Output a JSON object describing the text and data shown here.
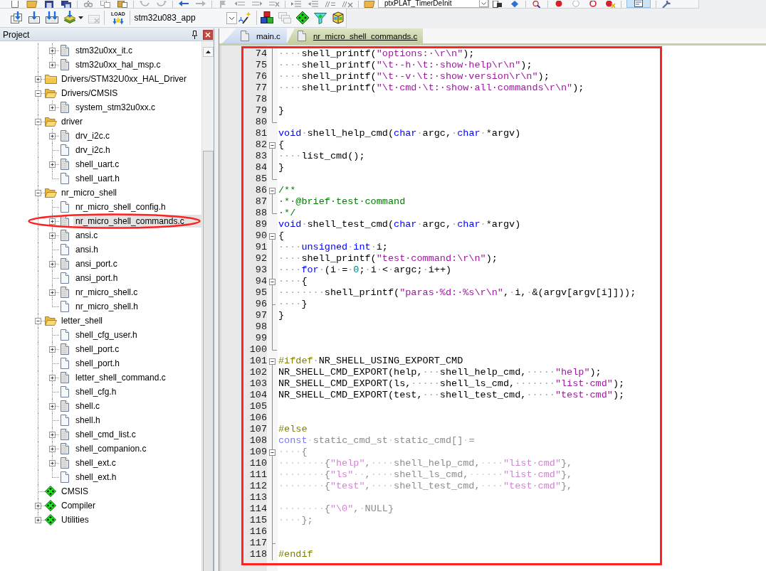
{
  "toolbar_top": {
    "groups": [
      {
        "items": [
          {
            "kind": "new",
            "pressed": false
          },
          {
            "kind": "open",
            "pressed": false
          },
          {
            "kind": "save",
            "pressed": false
          },
          {
            "kind": "save_all",
            "pressed": false
          }
        ]
      },
      {
        "items": [
          {
            "kind": "cut",
            "pressed": false
          },
          {
            "kind": "copy",
            "pressed": false
          },
          {
            "kind": "paste",
            "pressed": false
          }
        ]
      },
      {
        "items": [
          {
            "kind": "undo",
            "pressed": false
          },
          {
            "kind": "redo",
            "pressed": false
          }
        ]
      },
      {
        "items": [
          {
            "kind": "back",
            "pressed": false
          },
          {
            "kind": "forward",
            "pressed": false
          }
        ]
      },
      {
        "items": [
          {
            "kind": "bookmark",
            "pressed": false
          },
          {
            "kind": "bookmark_prev",
            "pressed": false
          },
          {
            "kind": "bookmark_next",
            "pressed": false
          },
          {
            "kind": "bookmark_clear",
            "pressed": false
          }
        ]
      },
      {
        "items": [
          {
            "kind": "indent",
            "pressed": false
          },
          {
            "kind": "outdent",
            "pressed": false
          },
          {
            "kind": "comment",
            "pressed": false
          },
          {
            "kind": "uncomment",
            "pressed": false
          }
        ]
      },
      {
        "items": [
          {
            "kind": "find_in_files",
            "pressed": false
          },
          {
            "kind": "dropdown",
            "value": "ptxPLAT_TimerDeInit"
          },
          {
            "kind": "find",
            "pressed": false
          },
          {
            "kind": "incremental_find",
            "pressed": false
          }
        ]
      },
      {
        "items": [
          {
            "kind": "browse",
            "pressed": false
          }
        ]
      },
      {
        "items": [
          {
            "kind": "breakpoint",
            "pressed": false
          },
          {
            "kind": "breakpoint_off",
            "pressed": false
          },
          {
            "kind": "breakpoint_ring",
            "pressed": false
          },
          {
            "kind": "breakpoint_kill",
            "pressed": false
          }
        ]
      },
      {
        "items": [
          {
            "kind": "window",
            "pressed": true
          }
        ]
      },
      {
        "items": [
          {
            "kind": "configure",
            "pressed": false
          }
        ]
      }
    ]
  },
  "toolbar_build": {
    "groups": [
      {
        "items": [
          {
            "kind": "translate",
            "disabled": false
          },
          {
            "kind": "build",
            "disabled": false
          },
          {
            "kind": "rebuild",
            "disabled": false
          },
          {
            "kind": "batch_build",
            "disabled": false
          },
          {
            "kind": "stop_build",
            "disabled": true
          }
        ]
      },
      {
        "items": [
          {
            "kind": "load",
            "label": "LOAD",
            "disabled": false
          }
        ]
      },
      {
        "items": [
          {
            "kind": "dropdown",
            "value": "stm32u083_app"
          },
          {
            "kind": "options",
            "disabled": false
          }
        ]
      },
      {
        "items": [
          {
            "kind": "components",
            "disabled": false
          },
          {
            "kind": "windows",
            "disabled": true
          },
          {
            "kind": "diamond",
            "disabled": false
          },
          {
            "kind": "funnel",
            "disabled": false
          },
          {
            "kind": "packs",
            "disabled": false
          }
        ]
      }
    ]
  },
  "project": {
    "title": "Project",
    "tree": [
      {
        "children": [
          {
            "label": "stm32u0xx_it.c",
            "kind": "source",
            "expanded": false,
            "selected": false
          },
          {
            "label": "stm32u0xx_hal_msp.c",
            "kind": "source",
            "expanded": false,
            "selected": false
          }
        ]
      },
      {
        "label": "Drivers/STM32U0xx_HAL_Driver",
        "kind": "folder",
        "expanded": false,
        "selected": false
      },
      {
        "label": "Drivers/CMSIS",
        "kind": "folder",
        "expanded": true,
        "selected": false,
        "children": [
          {
            "label": "system_stm32u0xx.c",
            "kind": "source",
            "expanded": false,
            "selected": false
          }
        ]
      },
      {
        "label": "driver",
        "kind": "folder",
        "expanded": true,
        "selected": false,
        "children": [
          {
            "label": "drv_i2c.c",
            "kind": "source",
            "expanded": false,
            "selected": false
          },
          {
            "label": "drv_i2c.h",
            "kind": "header",
            "selected": false
          },
          {
            "label": "shell_uart.c",
            "kind": "source",
            "expanded": false,
            "selected": false
          },
          {
            "label": "shell_uart.h",
            "kind": "header",
            "selected": false
          }
        ]
      },
      {
        "label": "nr_micro_shell",
        "kind": "folder",
        "expanded": true,
        "selected": false,
        "children": [
          {
            "label": "nr_micro_shell_config.h",
            "kind": "header",
            "selected": false
          },
          {
            "label": "nr_micro_shell_commands.c",
            "kind": "source",
            "expanded": false,
            "selected": true
          },
          {
            "label": "ansi.c",
            "kind": "source",
            "expanded": false,
            "selected": false
          },
          {
            "label": "ansi.h",
            "kind": "header",
            "selected": false
          },
          {
            "label": "ansi_port.c",
            "kind": "source",
            "expanded": false,
            "selected": false
          },
          {
            "label": "ansi_port.h",
            "kind": "header",
            "selected": false
          },
          {
            "label": "nr_micro_shell.c",
            "kind": "source",
            "expanded": false,
            "selected": false
          },
          {
            "label": "nr_micro_shell.h",
            "kind": "header",
            "selected": false
          }
        ]
      },
      {
        "label": "letter_shell",
        "kind": "folder",
        "expanded": true,
        "selected": false,
        "children": [
          {
            "label": "shell_cfg_user.h",
            "kind": "header",
            "selected": false
          },
          {
            "label": "shell_port.c",
            "kind": "source",
            "expanded": false,
            "selected": false
          },
          {
            "label": "shell_port.h",
            "kind": "header",
            "selected": false
          },
          {
            "label": "letter_shell_command.c",
            "kind": "source",
            "expanded": false,
            "selected": false
          },
          {
            "label": "shell_cfg.h",
            "kind": "header",
            "selected": false
          },
          {
            "label": "shell.c",
            "kind": "source",
            "expanded": false,
            "selected": false
          },
          {
            "label": "shell.h",
            "kind": "header",
            "selected": false
          },
          {
            "label": "shell_cmd_list.c",
            "kind": "source",
            "expanded": false,
            "selected": false
          },
          {
            "label": "shell_companion.c",
            "kind": "source",
            "expanded": false,
            "selected": false
          },
          {
            "label": "shell_ext.c",
            "kind": "source",
            "expanded": false,
            "selected": false
          },
          {
            "label": "shell_ext.h",
            "kind": "header",
            "selected": false
          }
        ]
      },
      {
        "label": "CMSIS",
        "kind": "component",
        "selected": false
      },
      {
        "label": "Compiler",
        "kind": "component",
        "expanded": false,
        "selected": false
      },
      {
        "label": "Utilities",
        "kind": "component",
        "expanded": false,
        "selected": false
      }
    ]
  },
  "editor": {
    "tabs": [
      {
        "label": "main.c",
        "selected": false
      },
      {
        "label": "nr_micro_shell_commands.c",
        "selected": true
      }
    ],
    "lines": [
      {
        "number": "74",
        "kind": "inside",
        "inactive": false,
        "tokens": [
          {
            "kind": "space",
            "text": "····"
          },
          {
            "kind": "plain",
            "text": "shell_printf("
          },
          {
            "kind": "string",
            "text": "\"options:·\\r\\n\""
          },
          {
            "kind": "plain",
            "text": ");"
          }
        ]
      },
      {
        "number": "75",
        "kind": "inside",
        "inactive": false,
        "tokens": [
          {
            "kind": "space",
            "text": "····"
          },
          {
            "kind": "plain",
            "text": "shell_printf("
          },
          {
            "kind": "string",
            "text": "\"\\t·-h·\\t:·show·help\\r\\n\""
          },
          {
            "kind": "plain",
            "text": ");"
          }
        ]
      },
      {
        "number": "76",
        "kind": "inside",
        "inactive": false,
        "tokens": [
          {
            "kind": "space",
            "text": "····"
          },
          {
            "kind": "plain",
            "text": "shell_printf("
          },
          {
            "kind": "string",
            "text": "\"\\t·-v·\\t:·show·version\\r\\n\""
          },
          {
            "kind": "plain",
            "text": ");"
          }
        ]
      },
      {
        "number": "77",
        "kind": "inside",
        "inactive": false,
        "tokens": [
          {
            "kind": "space",
            "text": "····"
          },
          {
            "kind": "plain",
            "text": "shell_printf("
          },
          {
            "kind": "string",
            "text": "\"\\t·cmd·\\t:·show·all·commands\\r\\n\""
          },
          {
            "kind": "plain",
            "text": ");"
          }
        ]
      },
      {
        "number": "78",
        "kind": "inside"
      },
      {
        "number": "79",
        "kind": "inside",
        "inactive": false,
        "tokens": [
          {
            "kind": "plain",
            "text": "}"
          }
        ]
      },
      {
        "number": "80",
        "kind": "end"
      },
      {
        "number": "81",
        "kind": "plain",
        "inactive": false,
        "tokens": [
          {
            "kind": "keyword",
            "text": "void"
          },
          {
            "kind": "space",
            "text": "·"
          },
          {
            "kind": "plain",
            "text": "shell_help_cmd("
          },
          {
            "kind": "keyword",
            "text": "char"
          },
          {
            "kind": "space",
            "text": "·"
          },
          {
            "kind": "plain",
            "text": "argc,"
          },
          {
            "kind": "space",
            "text": "·"
          },
          {
            "kind": "keyword",
            "text": "char"
          },
          {
            "kind": "space",
            "text": "·"
          },
          {
            "kind": "plain",
            "text": "*argv)"
          }
        ]
      },
      {
        "number": "82",
        "kind": "start",
        "inactive": false,
        "tokens": [
          {
            "kind": "plain",
            "text": "{"
          }
        ]
      },
      {
        "number": "83",
        "kind": "inside",
        "inactive": false,
        "tokens": [
          {
            "kind": "space",
            "text": "····"
          },
          {
            "kind": "plain",
            "text": "list_cmd();"
          }
        ]
      },
      {
        "number": "84",
        "kind": "inside",
        "inactive": false,
        "tokens": [
          {
            "kind": "plain",
            "text": "}"
          }
        ]
      },
      {
        "number": "85",
        "kind": "end"
      },
      {
        "number": "86",
        "kind": "start",
        "inactive": false,
        "tokens": [
          {
            "kind": "comment",
            "text": "/**"
          }
        ]
      },
      {
        "number": "87",
        "kind": "inside",
        "inactive": false,
        "tokens": [
          {
            "kind": "comment",
            "text": "·*·@brief·test·command"
          }
        ]
      },
      {
        "number": "88",
        "kind": "end",
        "inactive": false,
        "tokens": [
          {
            "kind": "comment",
            "text": "·*/"
          }
        ]
      },
      {
        "number": "89",
        "kind": "plain",
        "inactive": false,
        "tokens": [
          {
            "kind": "keyword",
            "text": "void"
          },
          {
            "kind": "space",
            "text": "·"
          },
          {
            "kind": "plain",
            "text": "shell_test_cmd("
          },
          {
            "kind": "keyword",
            "text": "char"
          },
          {
            "kind": "space",
            "text": "·"
          },
          {
            "kind": "plain",
            "text": "argc,"
          },
          {
            "kind": "space",
            "text": "·"
          },
          {
            "kind": "keyword",
            "text": "char"
          },
          {
            "kind": "space",
            "text": "·"
          },
          {
            "kind": "plain",
            "text": "*argv)"
          }
        ]
      },
      {
        "number": "90",
        "kind": "start",
        "inactive": false,
        "tokens": [
          {
            "kind": "plain",
            "text": "{"
          }
        ]
      },
      {
        "number": "91",
        "kind": "inside",
        "inactive": false,
        "tokens": [
          {
            "kind": "space",
            "text": "····"
          },
          {
            "kind": "keyword",
            "text": "unsigned"
          },
          {
            "kind": "space",
            "text": "·"
          },
          {
            "kind": "keyword",
            "text": "int"
          },
          {
            "kind": "space",
            "text": "·"
          },
          {
            "kind": "plain",
            "text": "i;"
          }
        ]
      },
      {
        "number": "92",
        "kind": "inside",
        "inactive": false,
        "tokens": [
          {
            "kind": "space",
            "text": "····"
          },
          {
            "kind": "plain",
            "text": "shell_printf("
          },
          {
            "kind": "string",
            "text": "\"test·command:\\r\\n\""
          },
          {
            "kind": "plain",
            "text": ");"
          }
        ]
      },
      {
        "number": "93",
        "kind": "inside",
        "inactive": false,
        "tokens": [
          {
            "kind": "space",
            "text": "····"
          },
          {
            "kind": "keyword",
            "text": "for"
          },
          {
            "kind": "space",
            "text": "·"
          },
          {
            "kind": "plain",
            "text": "(i"
          },
          {
            "kind": "space",
            "text": "·"
          },
          {
            "kind": "plain",
            "text": "="
          },
          {
            "kind": "space",
            "text": "·"
          },
          {
            "kind": "number",
            "text": "0"
          },
          {
            "kind": "plain",
            "text": ";"
          },
          {
            "kind": "space",
            "text": "·"
          },
          {
            "kind": "plain",
            "text": "i"
          },
          {
            "kind": "space",
            "text": "·"
          },
          {
            "kind": "plain",
            "text": "<"
          },
          {
            "kind": "space",
            "text": "·"
          },
          {
            "kind": "plain",
            "text": "argc;"
          },
          {
            "kind": "space",
            "text": "·"
          },
          {
            "kind": "plain",
            "text": "i++)"
          }
        ]
      },
      {
        "number": "94",
        "kind": "start",
        "inactive": false,
        "tokens": [
          {
            "kind": "space",
            "text": "····"
          },
          {
            "kind": "plain",
            "text": "{"
          }
        ]
      },
      {
        "number": "95",
        "kind": "inside",
        "inactive": false,
        "tokens": [
          {
            "kind": "space",
            "text": "········"
          },
          {
            "kind": "plain",
            "text": "shell_printf("
          },
          {
            "kind": "string",
            "text": "\"paras·%d:·%s\\r\\n\""
          },
          {
            "kind": "plain",
            "text": ","
          },
          {
            "kind": "space",
            "text": "·"
          },
          {
            "kind": "plain",
            "text": "i,"
          },
          {
            "kind": "space",
            "text": "·"
          },
          {
            "kind": "plain",
            "text": "&(argv[argv[i]]));"
          }
        ]
      },
      {
        "number": "96",
        "kind": "branch",
        "inactive": false,
        "tokens": [
          {
            "kind": "space",
            "text": "····"
          },
          {
            "kind": "plain",
            "text": "}"
          }
        ]
      },
      {
        "number": "97",
        "kind": "inside",
        "inactive": false,
        "tokens": [
          {
            "kind": "plain",
            "text": "}"
          }
        ]
      },
      {
        "number": "98",
        "kind": "inside"
      },
      {
        "number": "99",
        "kind": "inside"
      },
      {
        "number": "100",
        "kind": "end"
      },
      {
        "number": "101",
        "kind": "start",
        "inactive": false,
        "tokens": [
          {
            "kind": "directive",
            "text": "#ifdef"
          },
          {
            "kind": "space",
            "text": "·"
          },
          {
            "kind": "plain",
            "text": "NR_SHELL_USING_EXPORT_CMD"
          }
        ]
      },
      {
        "number": "102",
        "kind": "inside",
        "inactive": false,
        "tokens": [
          {
            "kind": "plain",
            "text": "NR_SHELL_CMD_EXPORT(help,"
          },
          {
            "kind": "space",
            "text": "···"
          },
          {
            "kind": "plain",
            "text": "shell_help_cmd,"
          },
          {
            "kind": "space",
            "text": "·····"
          },
          {
            "kind": "string",
            "text": "\"help\""
          },
          {
            "kind": "plain",
            "text": ");"
          }
        ]
      },
      {
        "number": "103",
        "kind": "inside",
        "inactive": false,
        "tokens": [
          {
            "kind": "plain",
            "text": "NR_SHELL_CMD_EXPORT(ls,"
          },
          {
            "kind": "space",
            "text": "·····"
          },
          {
            "kind": "plain",
            "text": "shell_ls_cmd,"
          },
          {
            "kind": "space",
            "text": "·······"
          },
          {
            "kind": "string",
            "text": "\"list·cmd\""
          },
          {
            "kind": "plain",
            "text": ");"
          }
        ]
      },
      {
        "number": "104",
        "kind": "inside",
        "inactive": false,
        "tokens": [
          {
            "kind": "plain",
            "text": "NR_SHELL_CMD_EXPORT(test,"
          },
          {
            "kind": "space",
            "text": "···"
          },
          {
            "kind": "plain",
            "text": "shell_test_cmd,"
          },
          {
            "kind": "space",
            "text": "·····"
          },
          {
            "kind": "string",
            "text": "\"test·cmd\""
          },
          {
            "kind": "plain",
            "text": ");"
          }
        ]
      },
      {
        "number": "105",
        "kind": "inside"
      },
      {
        "number": "106",
        "kind": "inside"
      },
      {
        "number": "107",
        "kind": "inside",
        "inactive": false,
        "tokens": [
          {
            "kind": "directive",
            "text": "#else"
          }
        ]
      },
      {
        "number": "108",
        "kind": "inside",
        "inactive": true,
        "tokens": [
          {
            "kind": "keyword",
            "text": "const"
          },
          {
            "kind": "space",
            "text": "·"
          },
          {
            "kind": "plain",
            "text": "static_cmd_st"
          },
          {
            "kind": "space",
            "text": "·"
          },
          {
            "kind": "plain",
            "text": "static_cmd[]"
          },
          {
            "kind": "space",
            "text": "·"
          },
          {
            "kind": "plain",
            "text": "="
          }
        ]
      },
      {
        "number": "109",
        "kind": "start",
        "inactive": true,
        "tokens": [
          {
            "kind": "space",
            "text": "····"
          },
          {
            "kind": "plain",
            "text": "{"
          }
        ]
      },
      {
        "number": "110",
        "kind": "inside",
        "inactive": true,
        "tokens": [
          {
            "kind": "space",
            "text": "········"
          },
          {
            "kind": "plain",
            "text": "{"
          },
          {
            "kind": "string",
            "text": "\"help\""
          },
          {
            "kind": "plain",
            "text": ","
          },
          {
            "kind": "space",
            "text": "····"
          },
          {
            "kind": "plain",
            "text": "shell_help_cmd,"
          },
          {
            "kind": "space",
            "text": "····"
          },
          {
            "kind": "string",
            "text": "\"list·cmd\""
          },
          {
            "kind": "plain",
            "text": "},"
          }
        ]
      },
      {
        "number": "111",
        "kind": "inside",
        "inactive": true,
        "tokens": [
          {
            "kind": "space",
            "text": "········"
          },
          {
            "kind": "plain",
            "text": "{"
          },
          {
            "kind": "string",
            "text": "\"ls\""
          },
          {
            "kind": "space",
            "text": "··"
          },
          {
            "kind": "plain",
            "text": ","
          },
          {
            "kind": "space",
            "text": "····"
          },
          {
            "kind": "plain",
            "text": "shell_ls_cmd,"
          },
          {
            "kind": "space",
            "text": "······"
          },
          {
            "kind": "string",
            "text": "\"list·cmd\""
          },
          {
            "kind": "plain",
            "text": "},"
          }
        ]
      },
      {
        "number": "112",
        "kind": "inside",
        "inactive": true,
        "tokens": [
          {
            "kind": "space",
            "text": "········"
          },
          {
            "kind": "plain",
            "text": "{"
          },
          {
            "kind": "string",
            "text": "\"test\""
          },
          {
            "kind": "plain",
            "text": ","
          },
          {
            "kind": "space",
            "text": "····"
          },
          {
            "kind": "plain",
            "text": "shell_test_cmd,"
          },
          {
            "kind": "space",
            "text": "····"
          },
          {
            "kind": "string",
            "text": "\"test·cmd\""
          },
          {
            "kind": "plain",
            "text": "},"
          }
        ]
      },
      {
        "number": "113",
        "kind": "inside"
      },
      {
        "number": "114",
        "kind": "inside",
        "inactive": true,
        "tokens": [
          {
            "kind": "space",
            "text": "········"
          },
          {
            "kind": "plain",
            "text": "{"
          },
          {
            "kind": "string",
            "text": "\"\\0\""
          },
          {
            "kind": "plain",
            "text": ","
          },
          {
            "kind": "space",
            "text": "·"
          },
          {
            "kind": "plain",
            "text": "NULL}"
          }
        ]
      },
      {
        "number": "115",
        "kind": "inside",
        "inactive": true,
        "tokens": [
          {
            "kind": "space",
            "text": "····"
          },
          {
            "kind": "plain",
            "text": "};"
          }
        ]
      },
      {
        "number": "116",
        "kind": "inside"
      },
      {
        "number": "117",
        "kind": "branch"
      },
      {
        "number": "118",
        "kind": "inside",
        "inactive": false,
        "tokens": [
          {
            "kind": "directive",
            "text": "#endif"
          }
        ]
      }
    ]
  },
  "annotations": [
    {
      "kind": "ellipse"
    },
    {
      "kind": "rectangle"
    }
  ]
}
